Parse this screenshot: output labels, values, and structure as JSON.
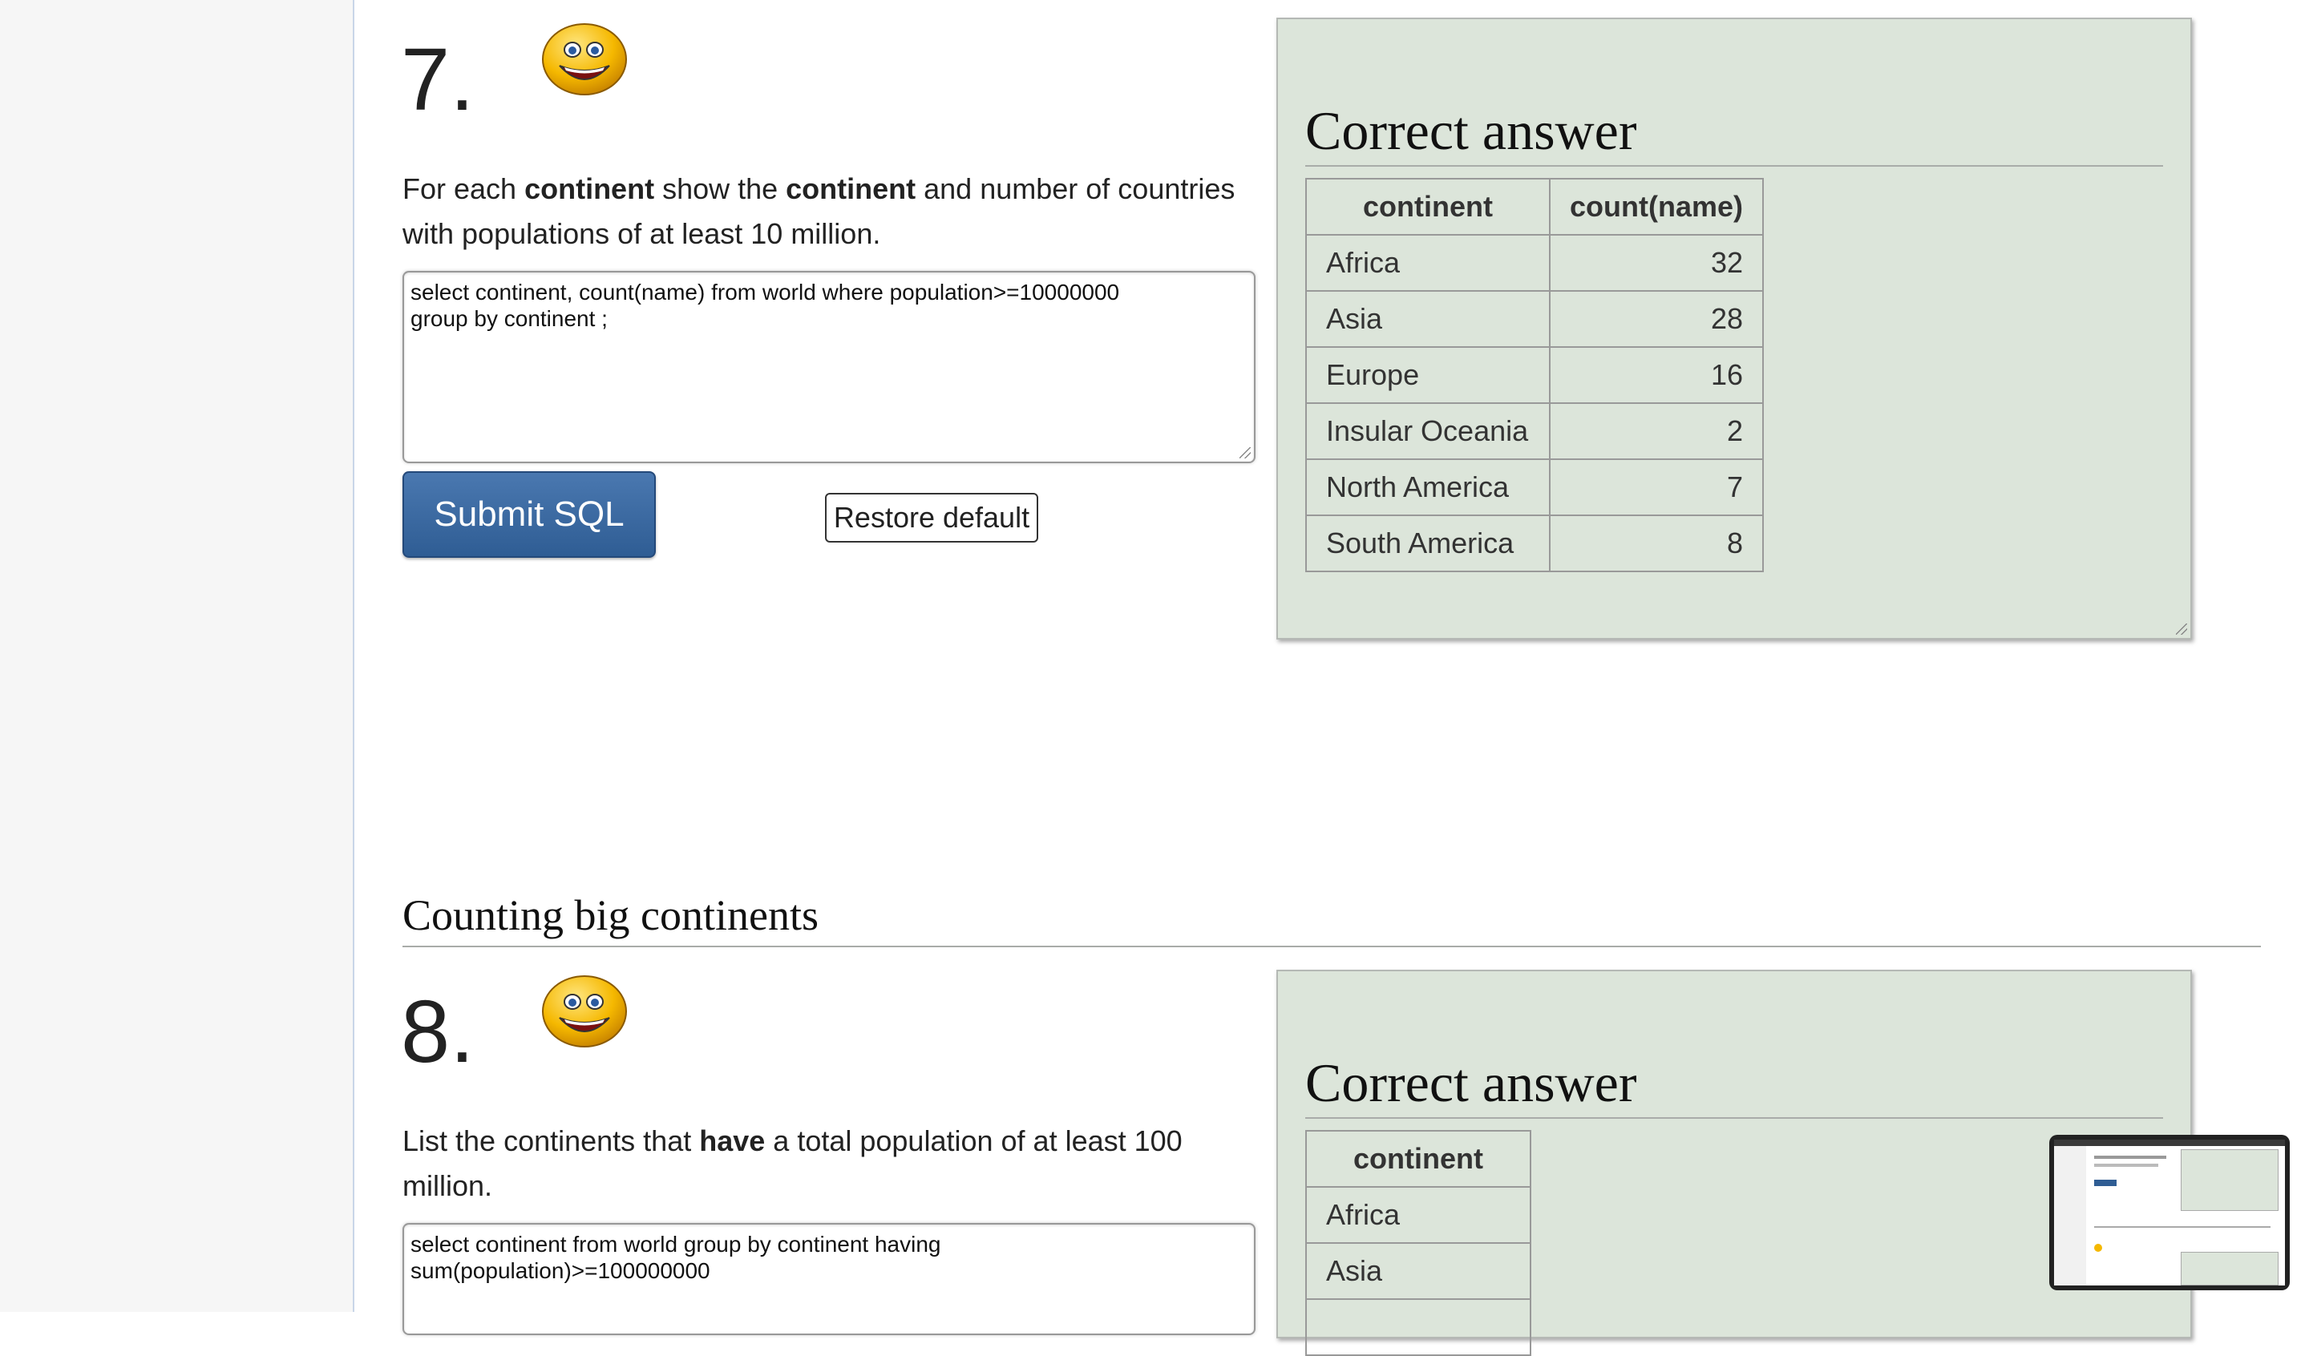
{
  "q7": {
    "number": "7.",
    "text_parts": [
      "For each ",
      "continent",
      " show the ",
      "continent",
      " and number of countries with populations of at least 10 million."
    ],
    "sql": "select continent, count(name) from world where population>=10000000\ngroup by continent ;",
    "submit_label": "Submit SQL",
    "restore_label": "Restore default",
    "answer_title": "Correct answer",
    "columns": [
      "continent",
      "count(name)"
    ],
    "rows": [
      [
        "Africa",
        "32"
      ],
      [
        "Asia",
        "28"
      ],
      [
        "Europe",
        "16"
      ],
      [
        "Insular Oceania",
        "2"
      ],
      [
        "North America",
        "7"
      ],
      [
        "South America",
        "8"
      ]
    ]
  },
  "section": {
    "heading": "Counting big continents"
  },
  "q8": {
    "number": "8.",
    "text_parts": [
      "List the continents that ",
      "have",
      " a total population of at least 100 million."
    ],
    "sql": "select continent from world group by continent having\nsum(population)>=100000000",
    "answer_title": "Correct answer",
    "columns": [
      "continent"
    ],
    "rows": [
      [
        "Africa"
      ],
      [
        "Asia"
      ],
      [
        ""
      ]
    ]
  },
  "colors": {
    "panel_bg": "#dce5da",
    "button_blue": "#2f5d94"
  },
  "icons": {
    "status": "smiley-face-icon"
  }
}
